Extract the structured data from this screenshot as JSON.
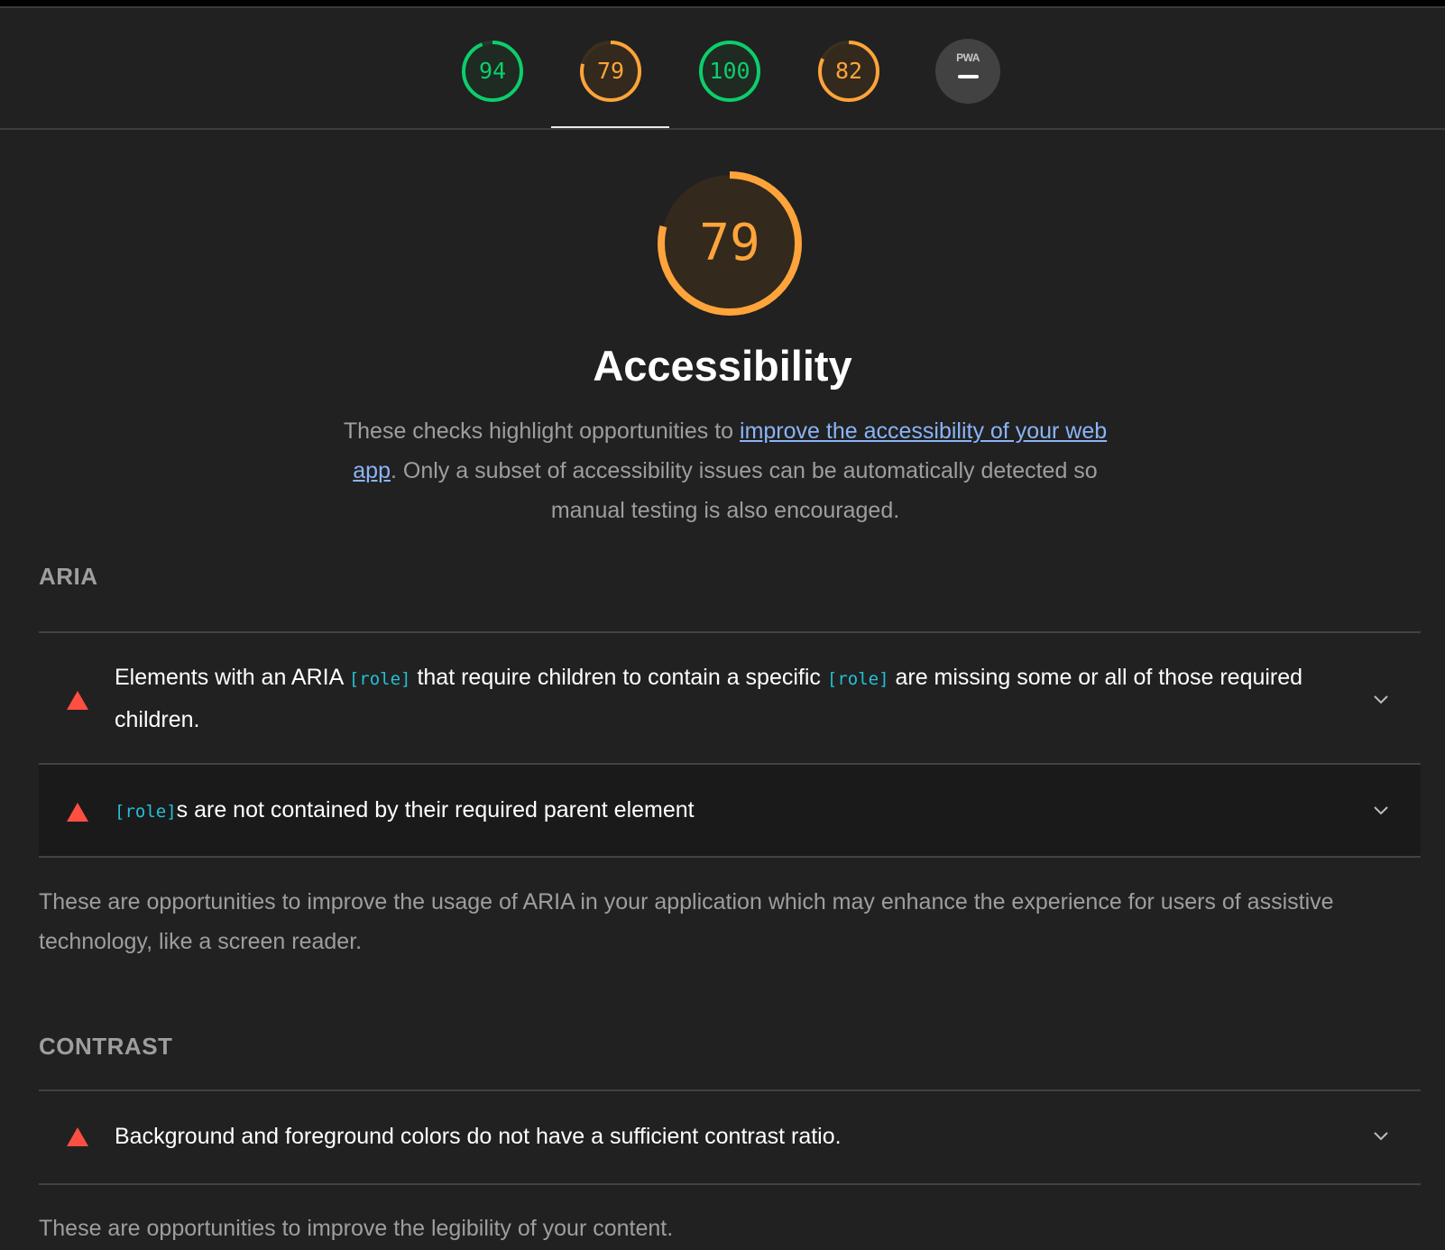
{
  "colors": {
    "pass": "#0cce6b",
    "average": "#ffa43a",
    "fail": "#ff4e42",
    "link": "#8ab4f8",
    "code": "#22c1d6"
  },
  "gauges": [
    {
      "label": "94",
      "score": 94,
      "rating": "pass"
    },
    {
      "label": "79",
      "score": 79,
      "rating": "average",
      "active": true
    },
    {
      "label": "100",
      "score": 100,
      "rating": "pass"
    },
    {
      "label": "82",
      "score": 82,
      "rating": "average"
    }
  ],
  "pwa_badge": {
    "label": "PWA"
  },
  "category": {
    "score_label": "79",
    "score": 79,
    "title": "Accessibility",
    "desc_before": "These checks highlight opportunities to ",
    "desc_link": "improve the accessibility of your web app",
    "desc_after": ". Only a subset of accessibility issues can be automatically detected so manual testing is also encouraged."
  },
  "groups": {
    "aria": {
      "title": "ARIA",
      "audits": [
        {
          "seg1": "Elements with an ARIA ",
          "code1": "[role]",
          "seg2": " that require children to contain a specific ",
          "code2": "[role]",
          "seg3": " are missing some or all of those required children."
        },
        {
          "code1": "[role]",
          "seg1": "s are not contained by their required parent element"
        }
      ],
      "description": "These are opportunities to improve the usage of ARIA in your application which may enhance the experience for users of assistive technology, like a screen reader."
    },
    "contrast": {
      "title": "CONTRAST",
      "audits": [
        {
          "seg1": "Background and foreground colors do not have a sufficient contrast ratio."
        }
      ],
      "description": "These are opportunities to improve the legibility of your content."
    }
  }
}
